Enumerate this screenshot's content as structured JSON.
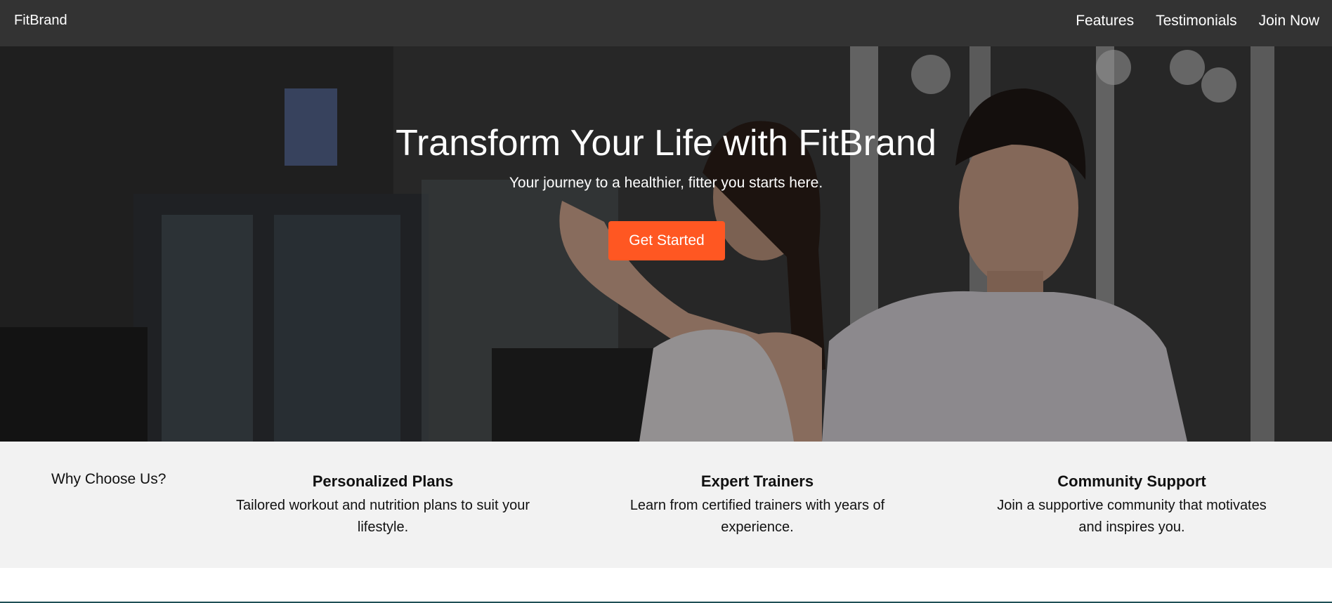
{
  "navbar": {
    "brand": "FitBrand",
    "links": [
      "Features",
      "Testimonials",
      "Join Now"
    ],
    "background": "#333333"
  },
  "hero": {
    "title": "Transform Your Life with FitBrand",
    "subtitle": "Your journey to a healthier, fitter you starts here.",
    "cta_label": "Get Started",
    "cta_color": "#ff5722"
  },
  "features": {
    "heading": "Why Choose Us?",
    "items": [
      {
        "title": "Personalized Plans",
        "description": "Tailored workout and nutrition plans to suit your lifestyle."
      },
      {
        "title": "Expert Trainers",
        "description": "Learn from certified trainers with years of experience."
      },
      {
        "title": "Community Support",
        "description": "Join a supportive community that motivates and inspires you."
      }
    ],
    "background": "#f2f2f2"
  }
}
